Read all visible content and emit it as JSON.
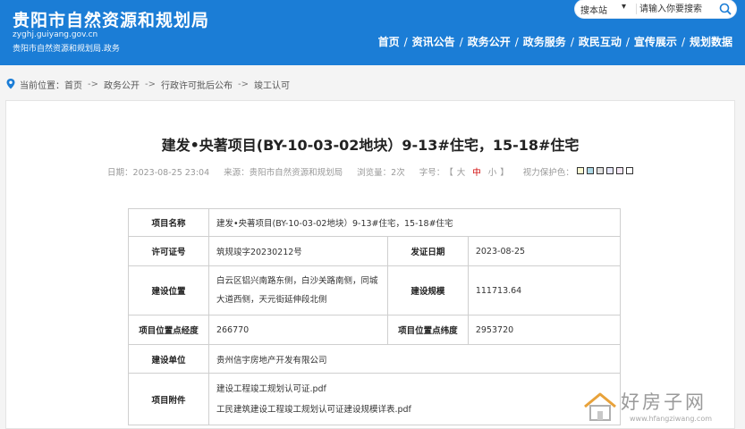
{
  "header": {
    "site_title": "贵阳市自然资源和规划局",
    "domain": "zyghj.guiyang.gov.cn",
    "subtitle": "贵阳市自然资源和规划局.政务",
    "search": {
      "scope": "搜本站",
      "placeholder": "请输入你要搜索"
    },
    "nav": [
      "首页",
      "资讯公告",
      "政务公开",
      "政务服务",
      "政民互动",
      "宣传展示",
      "规划数据"
    ]
  },
  "breadcrumb": {
    "prefix": "当前位置：",
    "items": [
      "首页",
      "政务公开",
      "行政许可批后公布",
      "竣工认可"
    ],
    "separator": "->"
  },
  "article": {
    "title": "建发•央著项目(BY-10-03-02地块）9-13#住宅，15-18#住宅",
    "meta": {
      "date": "日期：2023-08-25 23:04",
      "source": "来源：贵阳市自然资源和规划局",
      "views": "浏览量：2次",
      "font_size_label": "字号：",
      "font_sizes": [
        "大",
        "中",
        "小"
      ],
      "bracket_open": "【",
      "bracket_close": "】",
      "eye_care_label": "视力保护色："
    },
    "eye_care_colors": [
      "#fafad2",
      "#add8e6",
      "#e0e0e0",
      "#e6e6fa",
      "#f5e6f5",
      "#ffffff"
    ],
    "table": {
      "project_name_key": "项目名称",
      "project_name_val": "建发•央著项目(BY-10-03-02地块）9-13#住宅，15-18#住宅",
      "permit_no_key": "许可证号",
      "permit_no_val": "筑规竣字20230212号",
      "issue_date_key": "发证日期",
      "issue_date_val": "2023-08-25",
      "location_key": "建设位置",
      "location_val_line1": "白云区铝兴南路东侧，白沙关路南侧，同城",
      "location_val_line2": "大道西侧，天元街延伸段北侧",
      "scale_key": "建设规模",
      "scale_val": "111713.64",
      "longitude_key": "项目位置点经度",
      "longitude_val": "266770",
      "latitude_key": "项目位置点纬度",
      "latitude_val": "2953720",
      "unit_key": "建设单位",
      "unit_val": "贵州信宇房地产开发有限公司",
      "attachments_key": "项目附件",
      "attachments": [
        "建设工程竣工规划认可证.pdf",
        "工民建筑建设工程竣工规划认可证建设规模详表.pdf"
      ]
    }
  },
  "watermark": {
    "text": "好房子网",
    "url": "www.hfangziwang.com"
  }
}
